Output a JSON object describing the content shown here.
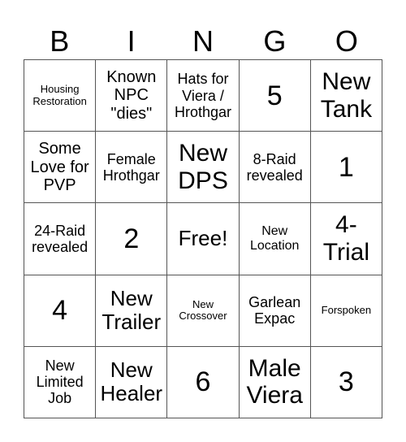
{
  "header": {
    "letters": [
      "B",
      "I",
      "N",
      "G",
      "O"
    ]
  },
  "board": {
    "rows": [
      [
        "Housing Restoration",
        "Known NPC \"dies\"",
        "Hats for Viera / Hrothgar",
        "5",
        "New Tank"
      ],
      [
        "Some Love for PVP",
        "Female Hrothgar",
        "New DPS",
        "8-Raid revealed",
        "1"
      ],
      [
        "24-Raid revealed",
        "2",
        "Free!",
        "New Location",
        "4-Trial"
      ],
      [
        "4",
        "New Trailer",
        "New Crossover",
        "Garlean Expac",
        "Forspoken"
      ],
      [
        "New Limited Job",
        "New Healer",
        "6",
        "Male Viera",
        "3"
      ]
    ]
  }
}
